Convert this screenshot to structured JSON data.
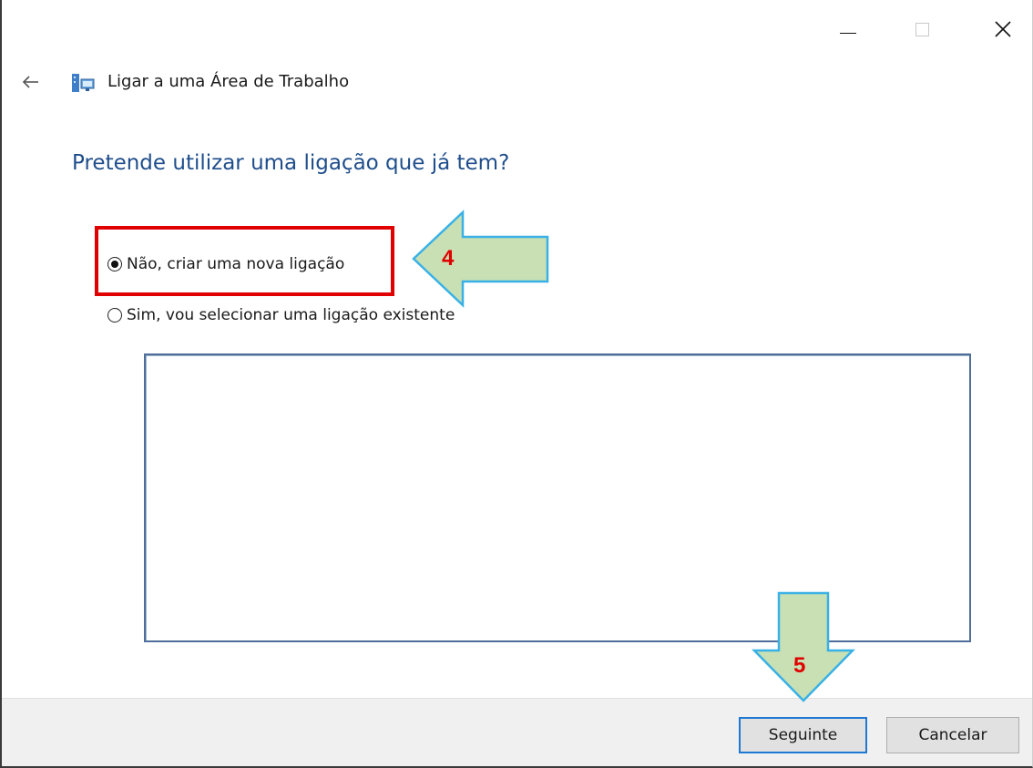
{
  "window": {
    "controls": {
      "minimize_icon": "minimize-icon",
      "maximize_icon": "maximize-icon",
      "close_icon": "close-icon"
    }
  },
  "header": {
    "back_icon": "back-arrow-icon",
    "app_icon": "workplace-connection-icon",
    "title": "Ligar a uma Área de Trabalho"
  },
  "question": "Pretende utilizar uma ligação que já tem?",
  "options": [
    {
      "label": "Não, criar uma nova ligação",
      "selected": true
    },
    {
      "label": "Sim, vou selecionar uma ligação existente",
      "selected": false
    }
  ],
  "connection_list": {
    "items": []
  },
  "buttons": {
    "next": "Seguinte",
    "cancel": "Cancelar"
  },
  "annotations": {
    "step_select_option": "4",
    "step_click_next": "5",
    "highlight_color": "#e00000",
    "arrow_fill": "#c8e0b4",
    "arrow_stroke": "#39b1e6"
  }
}
